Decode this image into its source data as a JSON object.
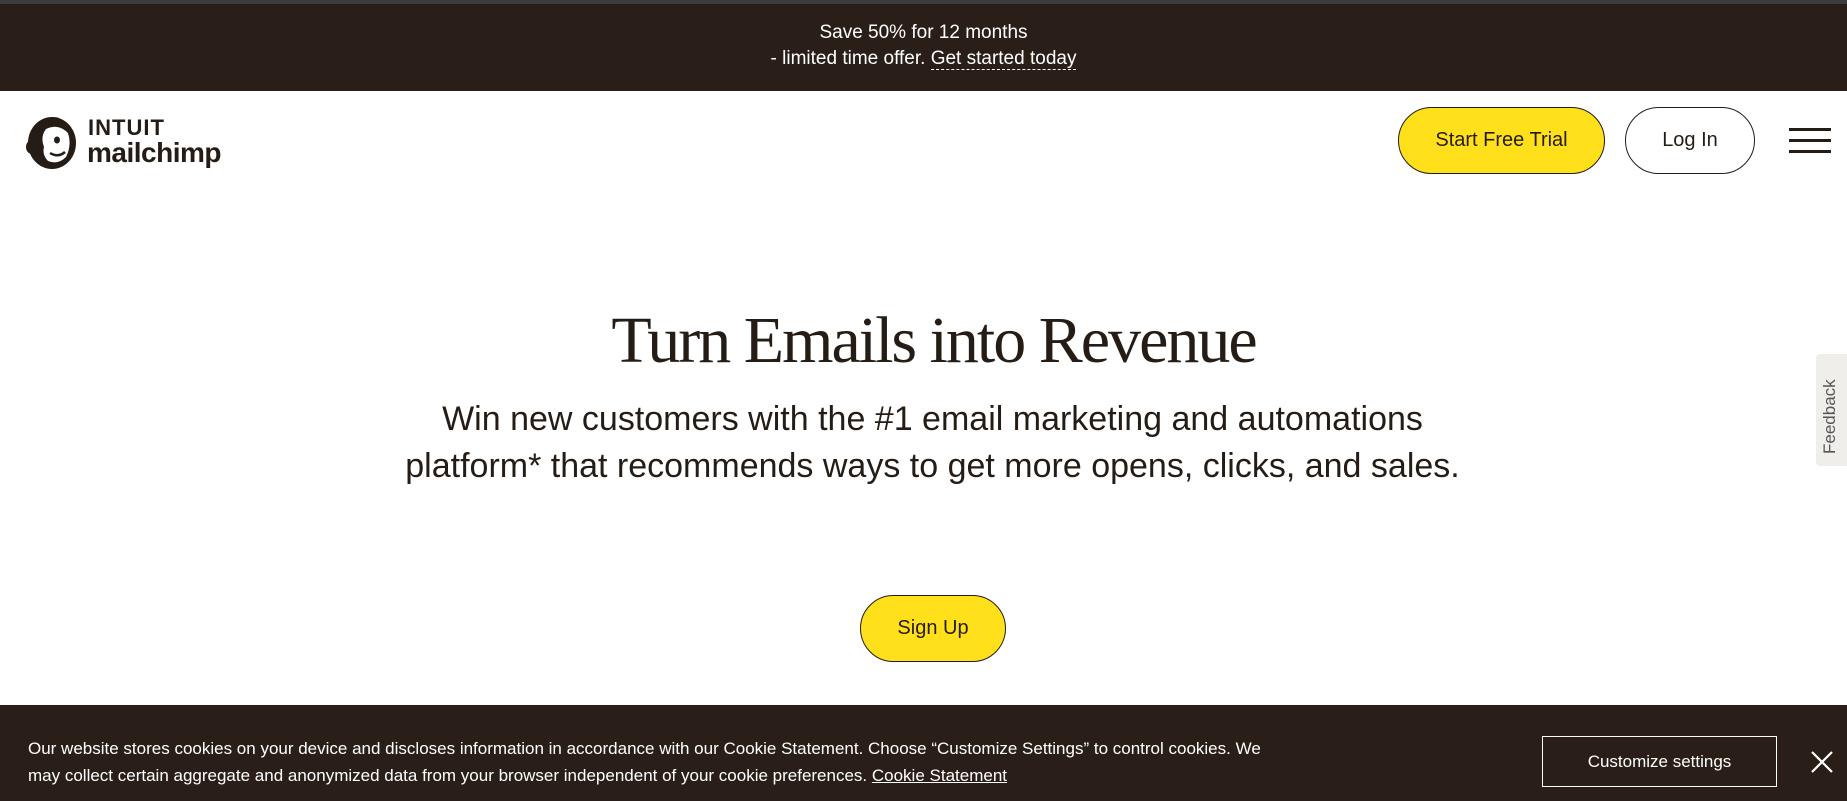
{
  "promo": {
    "line1": "Save 50% for 12 months",
    "line2_prefix": "- limited time offer.",
    "cta_link": "Get started today"
  },
  "header": {
    "logo": {
      "intuit": "INTUIT",
      "mailchimp": "mailchimp"
    },
    "start_trial_label": "Start Free Trial",
    "login_label": "Log In",
    "menu_icon": "hamburger-menu-icon"
  },
  "hero": {
    "title": "Turn Emails into Revenue",
    "subtitle": "Win new customers with the #1 email marketing and automations platform* that recommends ways to get more opens, clicks, and sales.",
    "signup_label": "Sign Up"
  },
  "feedback": {
    "label": "Feedback"
  },
  "cookie_banner": {
    "text": "Our website stores cookies on your device and discloses information in accordance with our Cookie Statement. Choose “Customize Settings” to control cookies. We may collect certain aggregate and anonymized data from your browser independent of your cookie preferences.",
    "link": "Cookie Statement",
    "customize_label": "Customize settings",
    "close_icon": "close-icon"
  },
  "colors": {
    "brand_yellow": "#ffe01b",
    "dark_brown": "#2a1f18",
    "text_dark": "#241c15"
  }
}
